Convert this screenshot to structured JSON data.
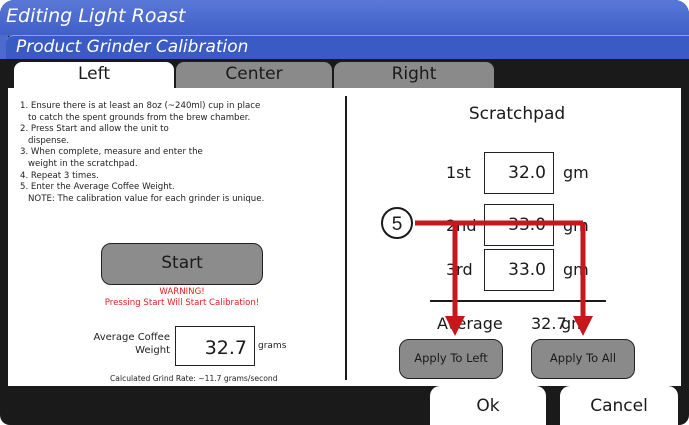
{
  "header": {
    "title": "Editing Light Roast",
    "subtitle": "Product Grinder Calibration"
  },
  "tabs": [
    {
      "label": "Left",
      "selected": true
    },
    {
      "label": "Center",
      "selected": false
    },
    {
      "label": "Right",
      "selected": false
    }
  ],
  "instructions": [
    "1. Ensure there is at least an 8oz (~240ml) cup in place",
    "   to catch the spent grounds from the brew chamber.",
    "2. Press Start and allow the unit to",
    "   dispense.",
    "3. When complete, measure and enter the",
    "   weight in the scratchpad.",
    "4. Repeat 3 times.",
    "5. Enter the Average Coffee Weight.",
    "   NOTE:  The calibration value for each grinder is unique."
  ],
  "start": {
    "label": "Start",
    "warning_line1": "WARNING!",
    "warning_line2": "Pressing Start Will Start Calibration!"
  },
  "average": {
    "label_line1": "Average Coffee",
    "label_line2": "Weight",
    "value": "32.7",
    "unit": "grams",
    "grind_rate": "Calculated Grind Rate: ~11.7 grams/second"
  },
  "scratchpad": {
    "title": "Scratchpad",
    "rows": [
      {
        "label": "1st",
        "value": "32.0",
        "unit": "gm"
      },
      {
        "label": "2nd",
        "value": "33.0",
        "unit": "gm"
      },
      {
        "label": "3rd",
        "value": "33.0",
        "unit": "gm"
      }
    ],
    "average_label": "Average",
    "average_value": "32.7",
    "average_unit": "gm",
    "apply_left": "Apply To Left",
    "apply_all": "Apply To All"
  },
  "footer": {
    "ok": "Ok",
    "cancel": "Cancel"
  },
  "callout": {
    "number": "5",
    "color": "#c8161d"
  }
}
